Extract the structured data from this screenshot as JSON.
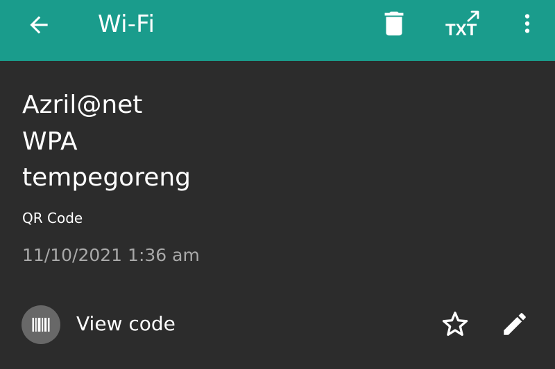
{
  "app_bar": {
    "title": "Wi-Fi",
    "back_icon": "arrow-left-icon",
    "delete_icon": "trash-icon",
    "export_label": "TXT",
    "export_icon": "export-txt-icon",
    "more_icon": "more-vert-icon",
    "color": "#1a9c8c"
  },
  "record": {
    "ssid": "Azril@net",
    "security": "WPA",
    "password": "tempegoreng",
    "format": "QR Code",
    "datetime": "11/10/2021 1:36 am"
  },
  "actions": {
    "view_code_label": "View code",
    "view_code_icon": "barcode-icon",
    "favorite_icon": "star-outline-icon",
    "edit_icon": "pencil-icon"
  },
  "colors": {
    "background": "#2c2c2c",
    "primary_text": "#ffffff",
    "secondary_text": "#a9a9a9",
    "icon_circle": "#686868"
  }
}
